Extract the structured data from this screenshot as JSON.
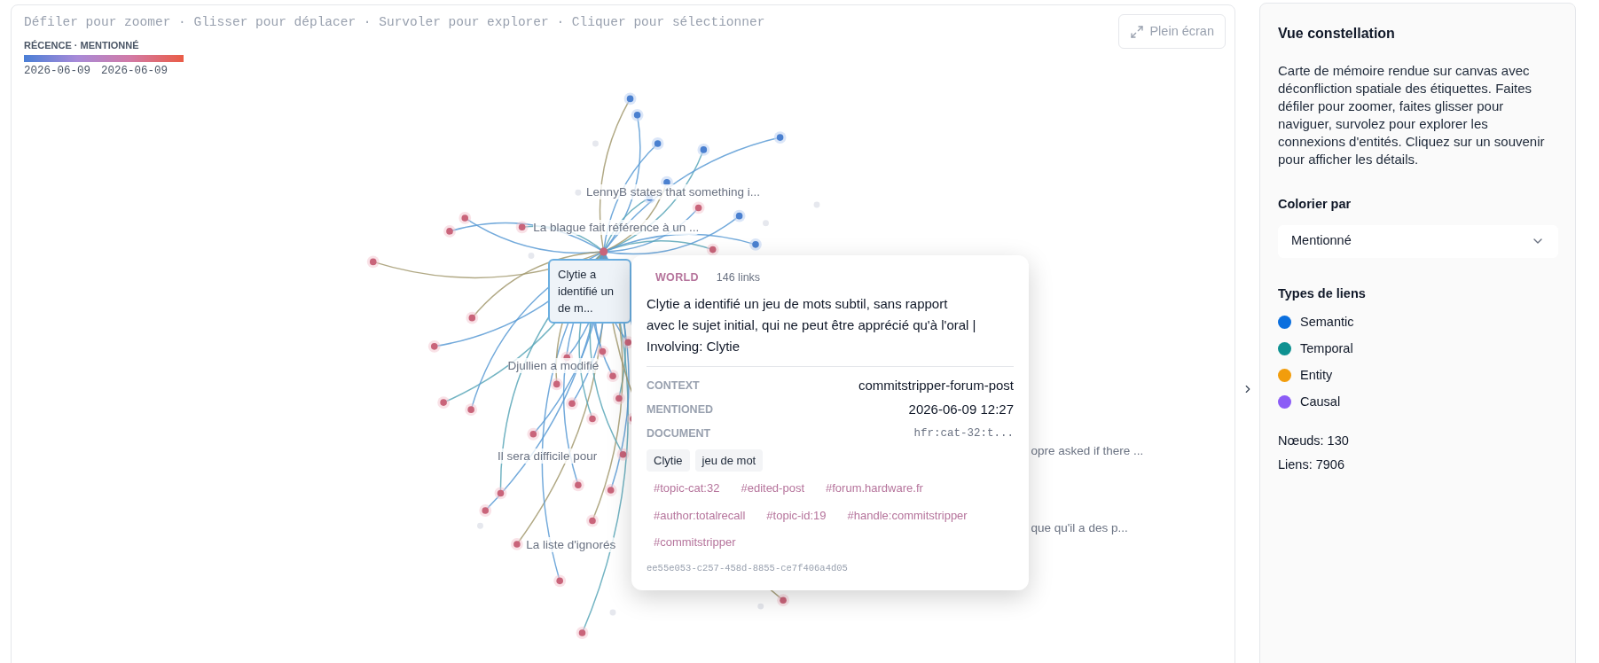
{
  "hint": "Défiler pour zoomer · Glisser pour déplacer · Survoler pour explorer · Cliquer pour sélectionner",
  "color_scale": {
    "title": "RÉCENCE · MENTIONNÉ",
    "start": "2026-06-09",
    "end": "2026-06-09"
  },
  "fullscreen_button": "Plein écran",
  "node_labels": [
    "LennyB states that something i...",
    "La blague fait référence à un ...",
    "Djullien a modifié",
    "Il sera difficile pour",
    "La liste d'ignorés",
    "opre asked if there ...",
    "que qu'il a des p..."
  ],
  "hovered_node": {
    "label": "Clytie a identifié un de m..."
  },
  "tooltip": {
    "kind": "WORLD",
    "links": "146 links",
    "text": "Clytie a identifié un jeu de mots subtil, sans rapport avec le sujet initial, qui ne peut être apprécié qu'à l'oral | Involving: Clytie",
    "fields": [
      {
        "label": "CONTEXT",
        "value": "commitstripper-forum-post",
        "kind": "text"
      },
      {
        "label": "MENTIONED",
        "value": "2026-06-09 12:27",
        "kind": "text"
      },
      {
        "label": "DOCUMENT",
        "value": "hfr:cat-32:t...",
        "kind": "code"
      }
    ],
    "entities": [
      "Clytie",
      "jeu de mot"
    ],
    "tags": [
      "#topic-cat:32",
      "#edited-post",
      "#forum.hardware.fr",
      "#author:totalrecall",
      "#topic-id:19",
      "#handle:commitstripper",
      "#commitstripper"
    ],
    "id": "ee55e053-c257-458d-8855-ce7f406a4d05"
  },
  "sidebar": {
    "title": "Vue constellation",
    "description": "Carte de mémoire rendue sur canvas avec déconfliction spatiale des étiquettes. Faites défiler pour zoomer, faites glisser pour naviguer, survolez pour explorer les connexions d'entités. Cliquez sur un souvenir pour afficher les détails.",
    "color_by": {
      "label": "Colorier par",
      "value": "Mentionné"
    },
    "link_types": {
      "title": "Types de liens",
      "items": [
        {
          "label": "Semantic",
          "color": "#0b6fde"
        },
        {
          "label": "Temporal",
          "color": "#0e9191"
        },
        {
          "label": "Entity",
          "color": "#f29d0c"
        },
        {
          "label": "Causal",
          "color": "#8b5cf6"
        }
      ]
    },
    "stats": [
      "Nœuds: 130",
      "Liens: 7906"
    ]
  }
}
